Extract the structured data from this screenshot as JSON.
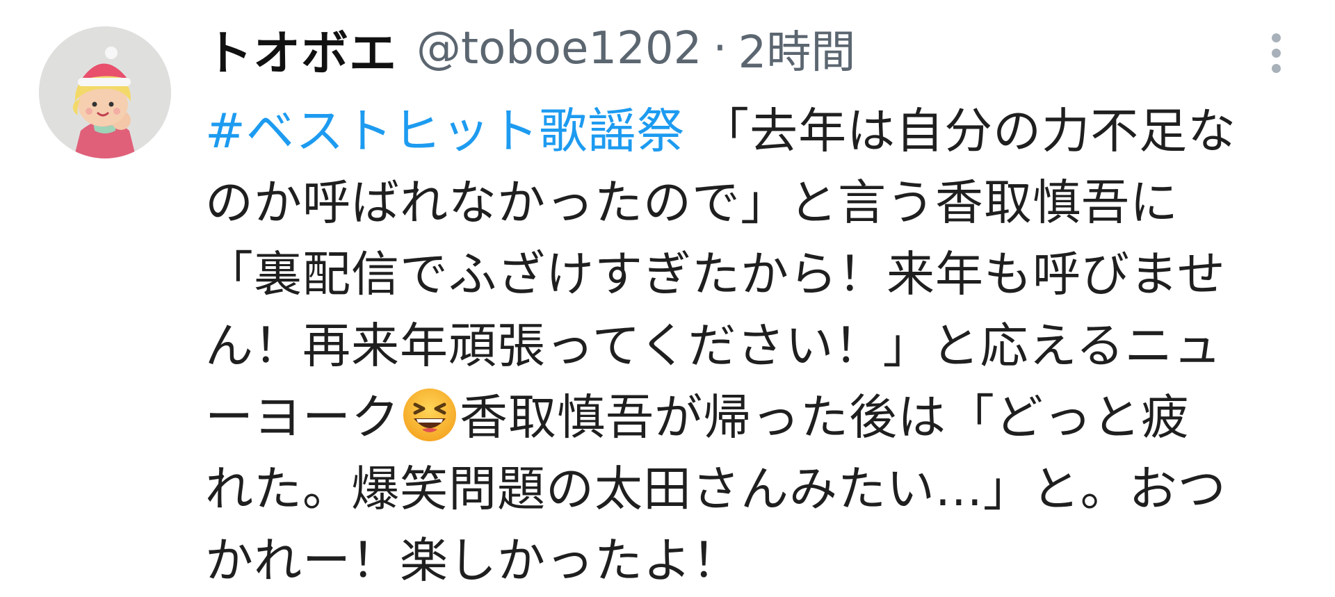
{
  "tweet": {
    "display_name": "トオボエ",
    "handle": "@toboe1202",
    "separator": "·",
    "time": "2時間",
    "hashtag": "#ベストヒット歌謡祭",
    "lines": [
      " 「去年は自分の力不足な",
      "のか呼ばれなかったので」と言う香取慎吾に",
      "「裏配信でふざけすぎたから！来年も呼びませ",
      "ん！再来年頑張ってください！」と応えるニュ",
      "ーヨーク",
      "香取慎吾が帰った後は「どっと疲",
      "れた。爆笑問題の太田さんみたい...」と。おつ",
      "かれー！楽しかったよ！"
    ],
    "emoji_icon": "laughing-squinting-face-icon",
    "avatar_icon": "figurine-avatar-icon",
    "more_icon": "vertical-ellipsis-icon"
  },
  "colors": {
    "hashtag": "#1d9bf0",
    "muted": "#5b6670",
    "text": "#1f1f1f"
  }
}
